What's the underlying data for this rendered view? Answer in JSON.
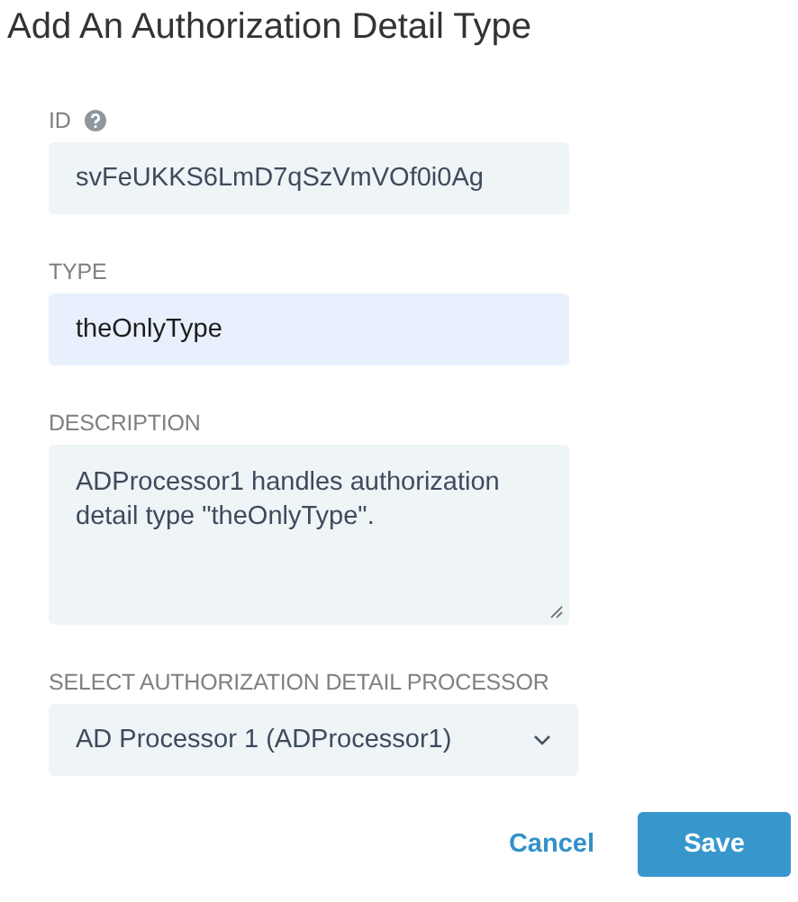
{
  "dialog": {
    "title": "Add An Authorization Detail Type"
  },
  "fields": [
    {
      "kind": "text",
      "label": "ID",
      "help_icon": true,
      "value": "svFeUKKS6LmD7qSzVmVOf0i0Ag",
      "focused": false
    },
    {
      "kind": "text",
      "label": "TYPE",
      "help_icon": false,
      "value": "theOnlyType",
      "focused": true
    },
    {
      "kind": "textarea",
      "label": "DESCRIPTION",
      "help_icon": false,
      "value": "ADProcessor1 handles authorization detail type \"theOnlyType\".",
      "focused": false
    },
    {
      "kind": "select",
      "label": "SELECT AUTHORIZATION DETAIL PROCESSOR",
      "help_icon": false,
      "value": "AD Processor 1 (ADProcessor1)",
      "focused": false
    }
  ],
  "buttons": [
    {
      "kind": "link",
      "label": "Cancel"
    },
    {
      "kind": "primary",
      "label": "Save"
    }
  ]
}
